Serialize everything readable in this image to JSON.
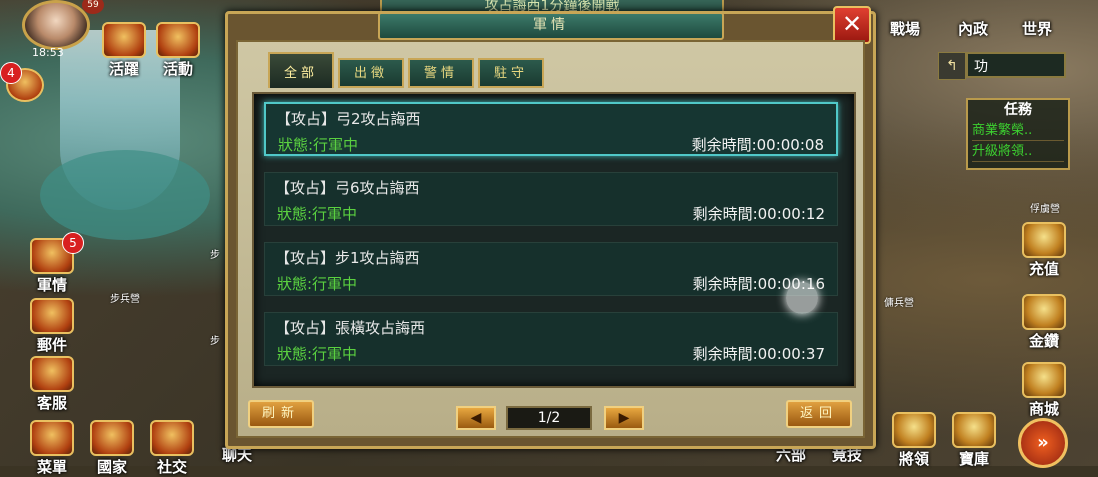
{
  "top_banner": "攻占誨西1分鐘後開戰",
  "hud": {
    "level": "59",
    "time": "18:53",
    "left_buttons": [
      {
        "label": "活躍"
      },
      {
        "label": "活動"
      },
      {
        "label": "軍情",
        "badge": "5"
      },
      {
        "label": "郵件"
      },
      {
        "label": "客服"
      },
      {
        "label": "菜單"
      },
      {
        "label": "國家"
      },
      {
        "label": "社交"
      },
      {
        "label": "聊天"
      }
    ],
    "gift_badge": "4",
    "map_labels": [
      "步兵營",
      "步",
      "步"
    ],
    "right_top_buttons": [
      {
        "label": "戰場"
      },
      {
        "label": "內政"
      },
      {
        "label": "世界"
      }
    ],
    "search_value": "功",
    "quest": {
      "title": "任務",
      "items": [
        "商業繁榮..",
        "升級將領.."
      ]
    },
    "right_map_labels": [
      "俘虜營",
      "傭兵營"
    ],
    "right_buttons": [
      {
        "label": "充值"
      },
      {
        "label": "金鑽"
      },
      {
        "label": "商城"
      }
    ],
    "bottom_right_buttons": [
      {
        "label": "六部"
      },
      {
        "label": "竟技"
      },
      {
        "label": "將領"
      },
      {
        "label": "寶庫"
      }
    ]
  },
  "dialog": {
    "title": "軍情",
    "close_label": "✕",
    "tabs": [
      {
        "label": "全部",
        "active": true
      },
      {
        "label": "出徵",
        "active": false
      },
      {
        "label": "警情",
        "active": false
      },
      {
        "label": "駐守",
        "active": false
      }
    ],
    "items": [
      {
        "title": "【攻占】弓2攻占誨西",
        "status": "狀態:行軍中",
        "remaining": "剩余時間:00:00:08",
        "selected": true
      },
      {
        "title": "【攻占】弓6攻占誨西",
        "status": "狀態:行軍中",
        "remaining": "剩余時間:00:00:12",
        "selected": false
      },
      {
        "title": "【攻占】步1攻占誨西",
        "status": "狀態:行軍中",
        "remaining": "剩余時間:00:00:16",
        "selected": false
      },
      {
        "title": "【攻占】張橫攻占誨西",
        "status": "狀態:行軍中",
        "remaining": "剩余時間:00:00:37",
        "selected": false
      }
    ],
    "refresh_label": "刷新",
    "back_label": "返回",
    "prev_label": "◀",
    "next_label": "▶",
    "page": "1/2"
  }
}
